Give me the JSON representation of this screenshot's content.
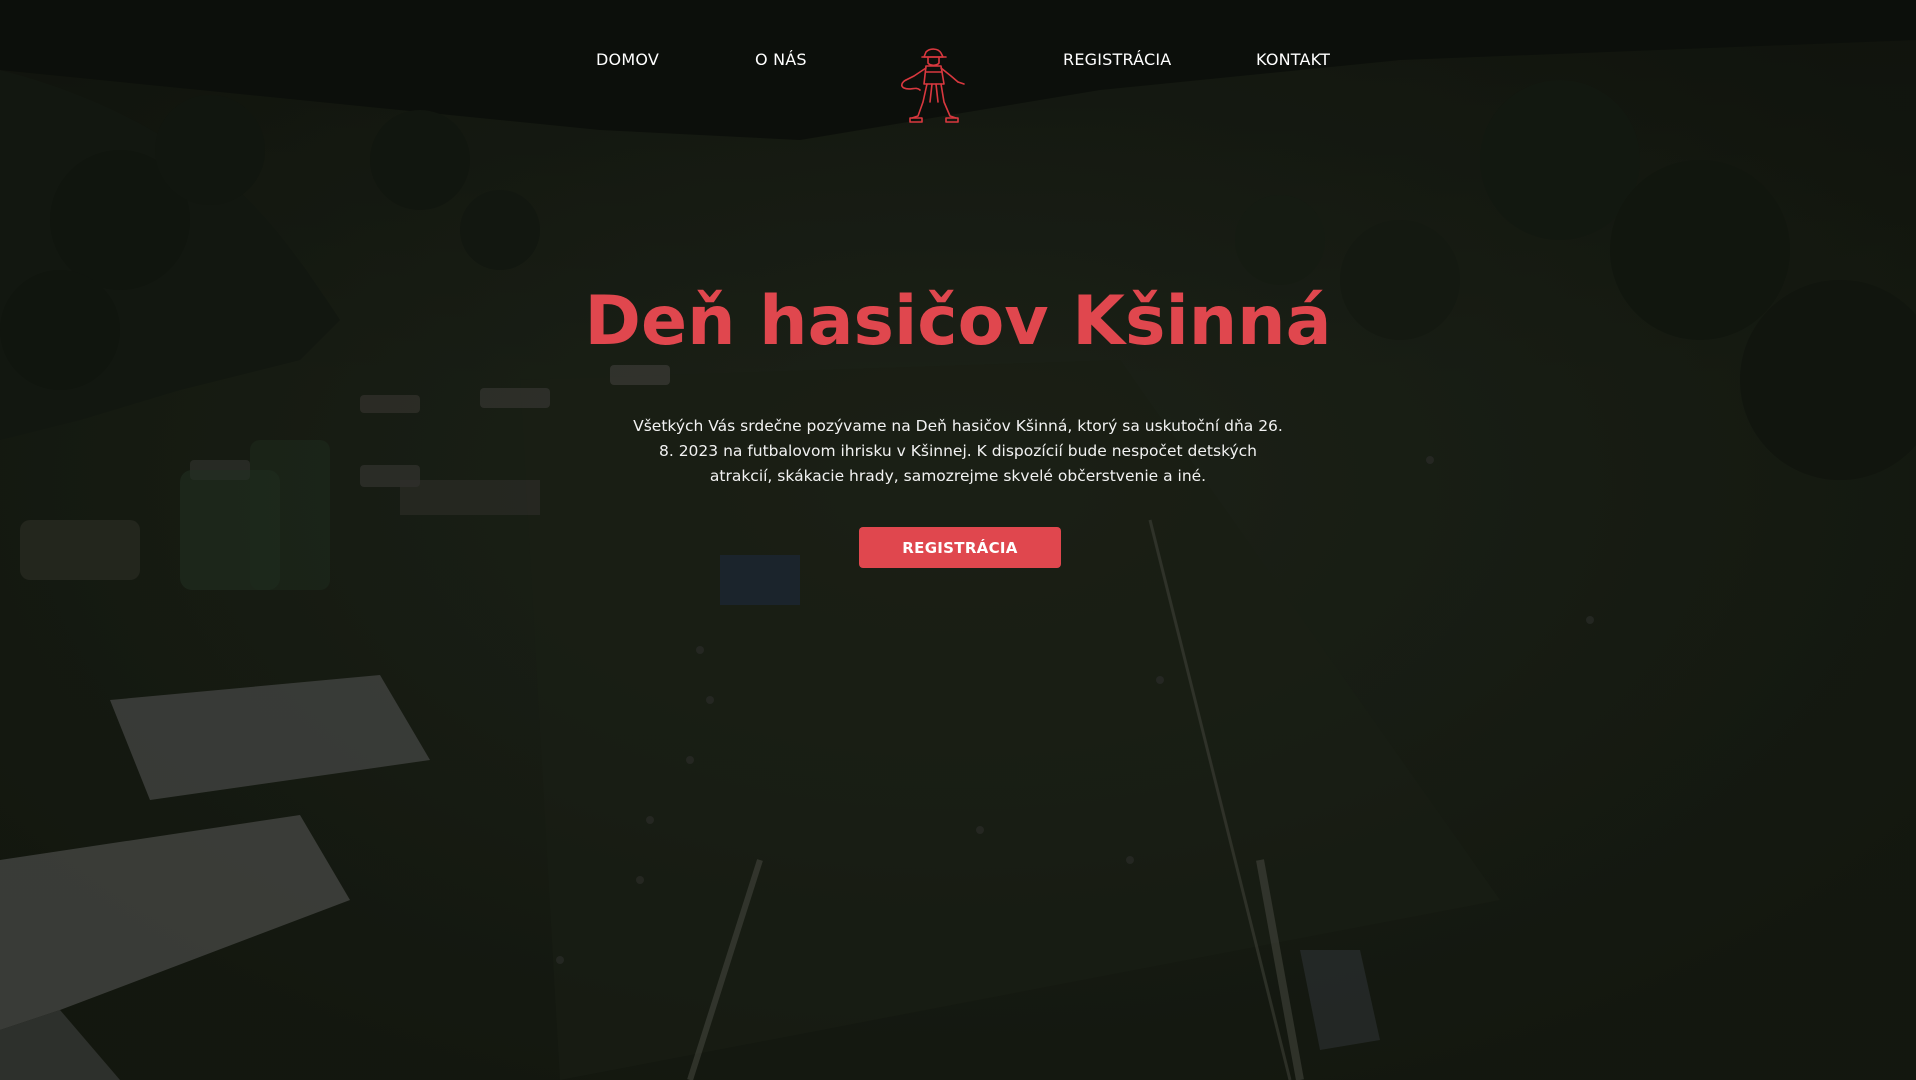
{
  "nav": {
    "items": [
      {
        "label": "DOMOV"
      },
      {
        "label": "O NÁS"
      },
      {
        "label": "REGISTRÁCIA"
      },
      {
        "label": "KONTAKT"
      }
    ],
    "logo_icon": "firefighter-logo-icon"
  },
  "hero": {
    "title": "Deň hasičov Kšinná",
    "description": "Všetkých Vás srdečne pozývame na Deň hasičov Kšinná, ktorý sa uskutoční dňa 26. 8. 2023 na futbalovom ihrisku v Kšinnej. K dispozícií bude nespočet detských atrakcií, skákacie hrady, samozrejme skvelé občerstvenie a iné.",
    "button_label": "REGISTRÁCIA"
  },
  "colors": {
    "accent": "#e0474e",
    "text": "#ffffff",
    "overlay": "#1a1d17"
  }
}
